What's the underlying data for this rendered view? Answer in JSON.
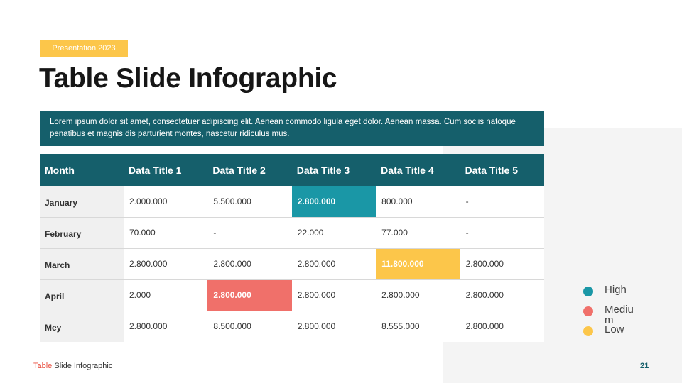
{
  "tag": "Presentation 2023",
  "title": "Table Slide Infographic",
  "description": "Lorem  ipsum dolor sit amet, consectetuer adipiscing elit. Aenean commodo ligula eget dolor. Aenean massa. Cum sociis natoque penatibus et magnis dis parturient montes, nascetur ridiculus mus.",
  "table": {
    "headers": [
      "Month",
      "Data Title 1",
      "Data Title 2",
      "Data Title 3",
      "Data Title 4",
      "Data Title 5"
    ],
    "rows": [
      {
        "month": "January",
        "cells": [
          "2.000.000",
          "5.500.000",
          "2.800.000",
          "800.000",
          "-"
        ]
      },
      {
        "month": "February",
        "cells": [
          "70.000",
          "-",
          "22.000",
          "77.000",
          "-"
        ]
      },
      {
        "month": "March",
        "cells": [
          "2.800.000",
          "2.800.000",
          "2.800.000",
          "11.800.000",
          "2.800.000"
        ]
      },
      {
        "month": "April",
        "cells": [
          "2.000",
          "2.800.000",
          "2.800.000",
          "2.800.000",
          "2.800.000"
        ]
      },
      {
        "month": "Mey",
        "cells": [
          "2.800.000",
          "8.500.000",
          "2.800.000",
          "8.555.000",
          "2.800.000"
        ]
      }
    ],
    "highlights": [
      {
        "row": 0,
        "col": 2,
        "level": "high"
      },
      {
        "row": 2,
        "col": 3,
        "level": "low"
      },
      {
        "row": 3,
        "col": 1,
        "level": "medium"
      }
    ]
  },
  "legend": [
    {
      "label": "High",
      "color": "#1a97a6"
    },
    {
      "label": "Medium",
      "color": "#f0706a"
    },
    {
      "label": "Low",
      "color": "#fcc64a"
    }
  ],
  "footer": {
    "accent": "Table",
    "text": " Slide Infographic"
  },
  "page_number": "21",
  "colors": {
    "primary": "#155f6b",
    "high": "#1a97a6",
    "medium": "#f0706a",
    "low": "#fcc64a",
    "tag": "#fcc64a"
  }
}
